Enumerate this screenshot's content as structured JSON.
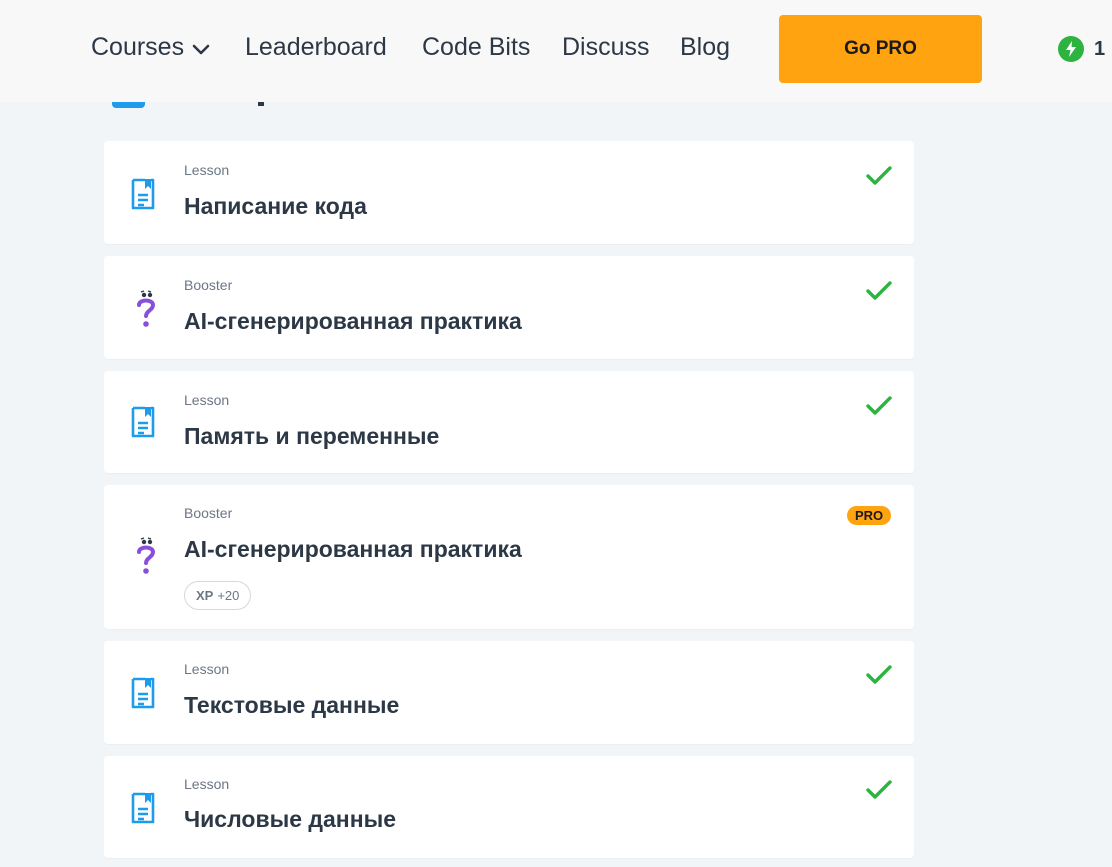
{
  "header": {
    "nav": [
      {
        "label": "Courses"
      },
      {
        "label": "Leaderboard"
      },
      {
        "label": "Code Bits"
      },
      {
        "label": "Discuss"
      },
      {
        "label": "Blog"
      }
    ],
    "go_pro_label": "Go PRO",
    "xp_count": "1",
    "colors": {
      "accent": "#ffa310",
      "xp_green": "#2fb340"
    }
  },
  "cards": [
    {
      "type": "Lesson",
      "title": "Написание кода",
      "icon": "lesson-icon",
      "completed": true
    },
    {
      "type": "Booster",
      "title": "AI-сгенерированная практика",
      "icon": "booster-icon",
      "completed": true
    },
    {
      "type": "Lesson",
      "title": "Память и переменные",
      "icon": "lesson-icon",
      "completed": true
    },
    {
      "type": "Booster",
      "title": "AI-сгенерированная практика",
      "icon": "booster-icon",
      "completed": false,
      "badge": "PRO",
      "xp_label": "XP",
      "xp_value": "+20"
    },
    {
      "type": "Lesson",
      "title": "Текстовые данные",
      "icon": "lesson-icon",
      "completed": true
    },
    {
      "type": "Lesson",
      "title": "Числовые данные",
      "icon": "lesson-icon",
      "completed": true
    }
  ],
  "colors": {
    "lesson_icon": "#1e9bea",
    "booster_icon": "#8a4fd8",
    "check": "#2fb340"
  }
}
